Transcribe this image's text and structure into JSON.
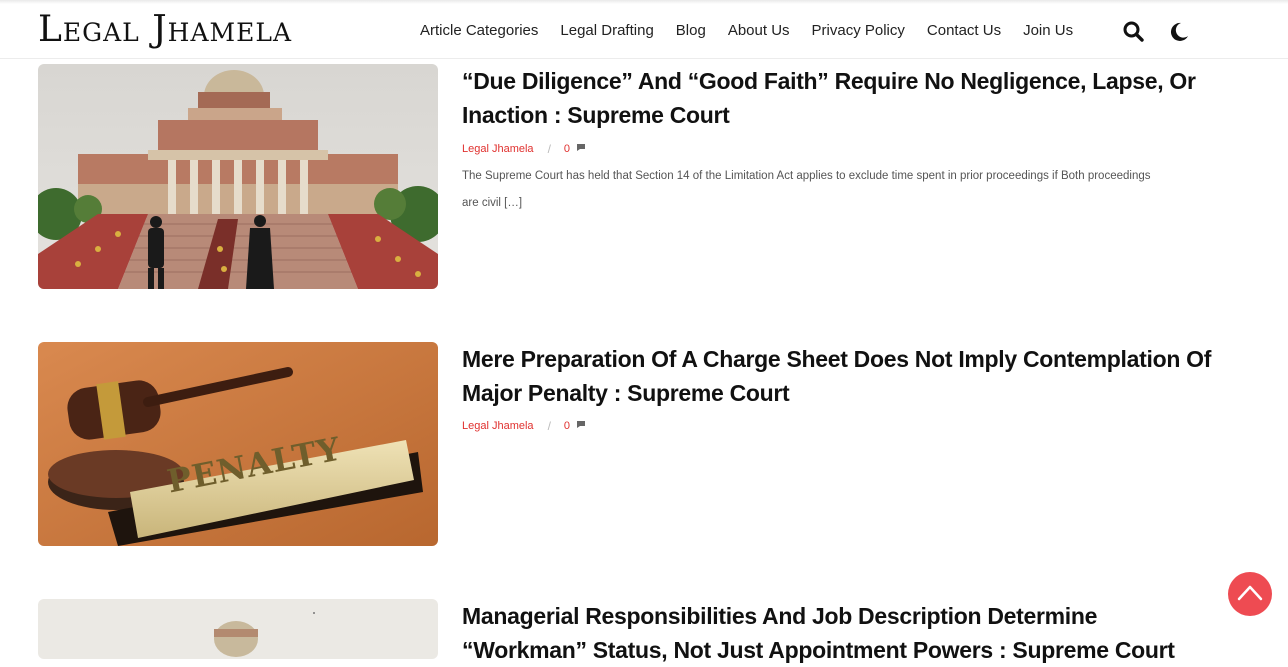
{
  "site": {
    "logo": "Legal Jhamela",
    "nav": [
      "Article Categories",
      "Legal Drafting",
      "Blog",
      "About Us",
      "Privacy Policy",
      "Contact Us",
      "Join Us"
    ],
    "accent": "#e0312f",
    "scroll_top_color": "#ee4b52"
  },
  "posts": [
    {
      "title": "“Due Diligence” And “Good Faith” Require No Negligence, Lapse, Or Inaction : Supreme Court",
      "author": "Legal Jhamela",
      "comments": "0",
      "excerpt": "The Supreme Court has held that Section 14 of the Limitation Act applies to exclude time spent in prior proceedings if Both proceedings are civil […]",
      "image": "supreme-court-building"
    },
    {
      "title": "Mere Preparation Of A Charge Sheet Does Not Imply Contemplation Of Major Penalty : Supreme Court",
      "author": "Legal Jhamela",
      "comments": "0",
      "image_text": "PENALTY",
      "image": "gavel-penalty-plaque"
    },
    {
      "title": "Managerial Responsibilities And Job Description Determine “Workman” Status, Not Just Appointment Powers : Supreme Court",
      "image": "supreme-court-dome"
    }
  ]
}
